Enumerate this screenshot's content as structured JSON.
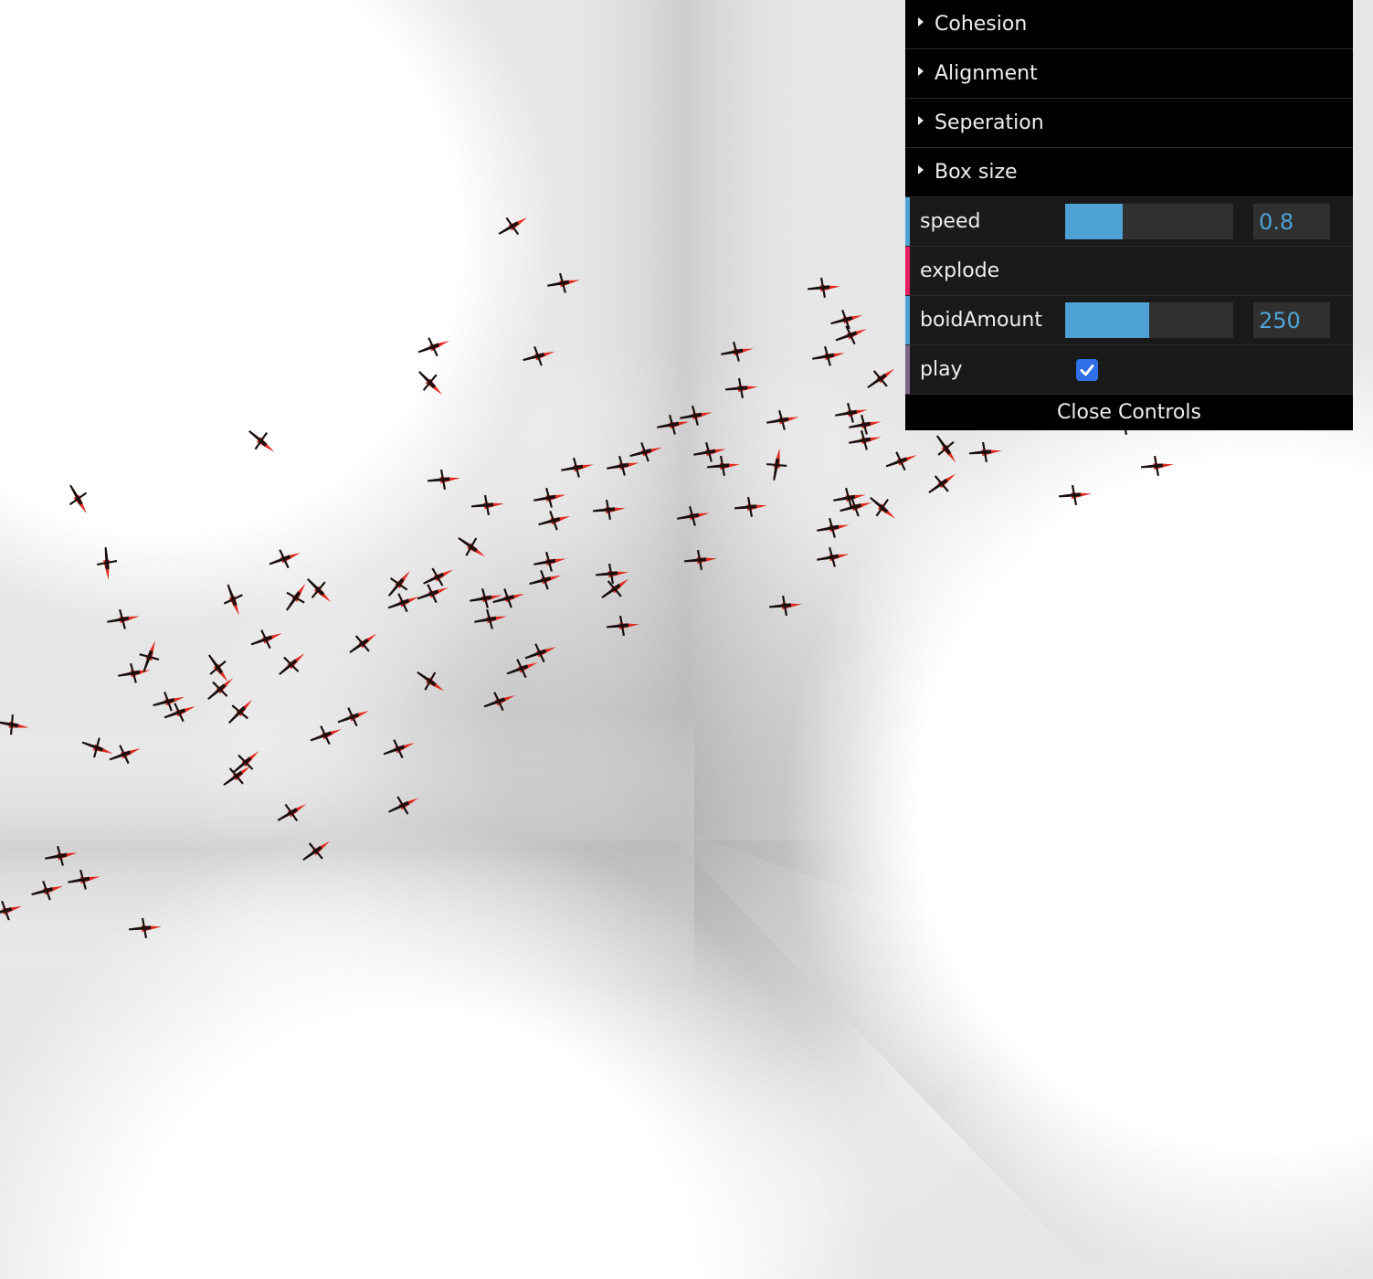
{
  "gui": {
    "folders": [
      {
        "label": "Cohesion"
      },
      {
        "label": "Alignment"
      },
      {
        "label": "Seperation"
      },
      {
        "label": "Box size"
      }
    ],
    "controls": {
      "speed": {
        "label": "speed",
        "value": "0.8",
        "fill_fraction": 0.34,
        "color": "#4fa3d4"
      },
      "explode": {
        "label": "explode",
        "color": "#e61d5f"
      },
      "boidAmount": {
        "label": "boidAmount",
        "value": "250",
        "fill_fraction": 0.5,
        "color": "#4fa3d4"
      },
      "play": {
        "label": "play",
        "checked": true,
        "color": "#806787"
      }
    },
    "close_label": "Close Controls"
  },
  "scene": {
    "boid_colors": {
      "body": "#1a0f0f",
      "wing": "#e02b20"
    },
    "background": "light gray room corner"
  }
}
